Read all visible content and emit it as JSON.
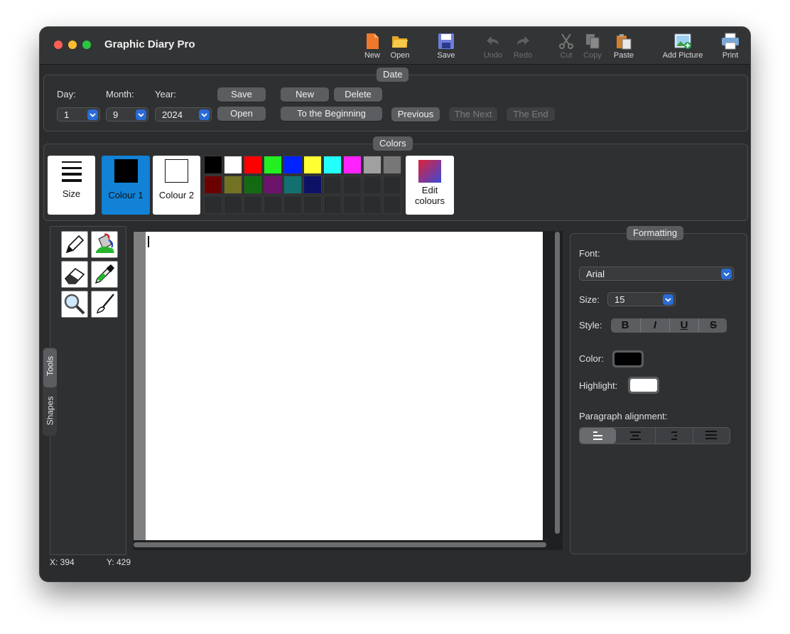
{
  "app": {
    "title": "Graphic Diary Pro"
  },
  "toolbar": {
    "new": "New",
    "open": "Open",
    "save": "Save",
    "undo": "Undo",
    "redo": "Redo",
    "cut": "Cut",
    "copy": "Copy",
    "paste": "Paste",
    "add_picture": "Add Picture",
    "print": "Print"
  },
  "date": {
    "title": "Date",
    "day_label": "Day:",
    "month_label": "Month:",
    "year_label": "Year:",
    "day": "1",
    "month": "9",
    "year": "2024",
    "save": "Save",
    "open": "Open",
    "new": "New",
    "delete": "Delete",
    "to_beginning": "To the Beginning",
    "previous": "Previous",
    "next": "The Next",
    "end": "The End"
  },
  "colors": {
    "title": "Colors",
    "size": "Size",
    "colour1": "Colour 1",
    "colour2": "Colour 2",
    "edit": "Edit colours",
    "palette_row1": [
      "#000000",
      "#ffffff",
      "#ff0000",
      "#22ee22",
      "#0022ff",
      "#ffff33",
      "#22ffff",
      "#ff22ff",
      "#a0a0a0",
      "#777777"
    ],
    "palette_row2": [
      "#6b0000",
      "#727222",
      "#126b12",
      "#6b126b",
      "#137070",
      "#0d1266"
    ],
    "colour1_value": "#000000",
    "colour2_value": "#ffffff",
    "accent": "#1182d6"
  },
  "side_tabs": {
    "tools": "Tools",
    "shapes": "Shapes"
  },
  "tools": [
    "pencil-tool",
    "fill-tool",
    "eraser-tool",
    "eyedropper-tool",
    "magnifier-tool",
    "brush-tool"
  ],
  "formatting": {
    "title": "Formatting",
    "font_label": "Font:",
    "font": "Arial",
    "size_label": "Size:",
    "size": "15",
    "style_label": "Style:",
    "bold": "B",
    "italic": "I",
    "underline": "U",
    "strike": "S",
    "color_label": "Color:",
    "highlight_label": "Highlight:",
    "text_color": "#000000",
    "highlight_color": "#ffffff",
    "paragraph_label": "Paragraph alignment:"
  },
  "status": {
    "x": "X: 394",
    "y": "Y: 429"
  }
}
